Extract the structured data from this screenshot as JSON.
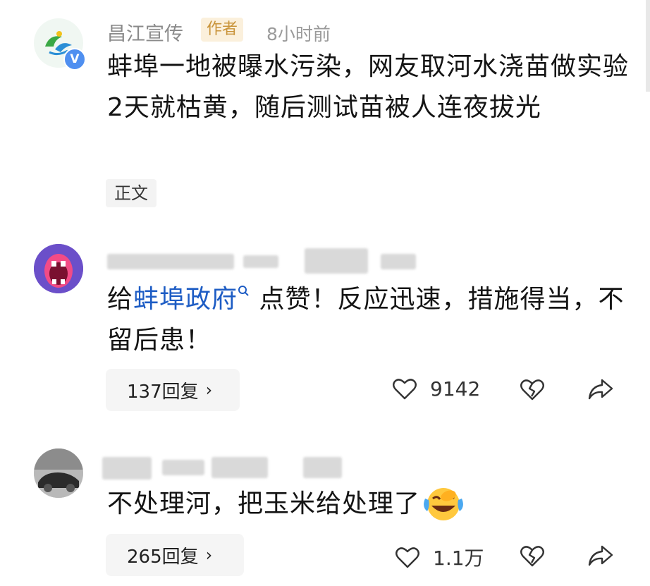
{
  "post": {
    "author": "昌江宣传",
    "author_badge": "作者",
    "time": "8小时前",
    "text": "蚌埠一地被曝水污染，网友取河水浇苗做实验2天就枯黄，随后测试苗被人连夜拔光",
    "tag": "正文",
    "verified_badge": "V"
  },
  "comments": [
    {
      "text_prefix": "给",
      "link_text": "蚌埠政府",
      "text_suffix": "点赞！反应迅速，措施得当，不留后患！",
      "reply_label": "137回复",
      "like_count": "9142"
    },
    {
      "text": "不处理河，把玉米给处理了",
      "reply_label": "265回复",
      "like_count": "1.1万"
    }
  ],
  "icons": {
    "like": "heart-icon",
    "dislike": "broken-heart-icon",
    "share": "share-arrow-icon",
    "search": "search-icon",
    "emoji": "laughing-crying-emoji-icon"
  },
  "colors": {
    "link": "#1d5cc4",
    "badge_text": "#c9943a",
    "badge_bg": "#fbf0dc"
  }
}
